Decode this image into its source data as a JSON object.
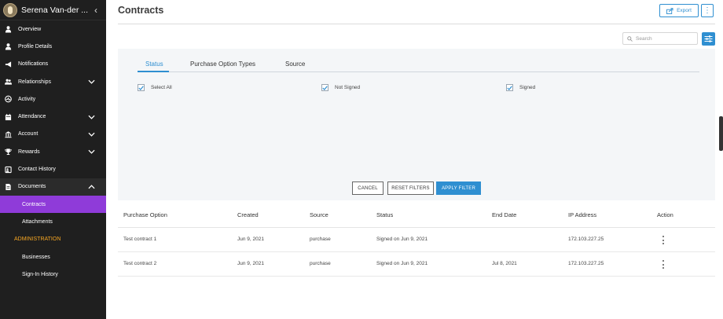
{
  "sidebar": {
    "user_name": "Serena Van-der ...",
    "items": [
      {
        "label": "Overview",
        "icon": "person-icon"
      },
      {
        "label": "Profile Details",
        "icon": "person-icon"
      },
      {
        "label": "Notifications",
        "icon": "megaphone-icon"
      },
      {
        "label": "Relationships",
        "icon": "people-icon"
      },
      {
        "label": "Activity",
        "icon": "activity-icon"
      },
      {
        "label": "Attendance",
        "icon": "calendar-icon"
      },
      {
        "label": "Account",
        "icon": "bank-icon"
      },
      {
        "label": "Rewards",
        "icon": "trophy-icon"
      },
      {
        "label": "Contact History",
        "icon": "contact-icon"
      },
      {
        "label": "Documents",
        "icon": "document-icon"
      }
    ],
    "sub_items": [
      "Contracts",
      "Attachments"
    ],
    "section_label": "ADMINISTRATION",
    "admin_items": [
      "Businesses",
      "Sign-In History"
    ]
  },
  "header": {
    "title": "Contracts",
    "export_label": "Export"
  },
  "search": {
    "placeholder": "Search"
  },
  "filters": {
    "tabs": [
      "Status",
      "Purchase Option Types",
      "Source"
    ],
    "checkboxes": [
      "Select All",
      "Not Signed",
      "Signed"
    ],
    "cancel_label": "CANCEL",
    "reset_label": "RESET FILTERS",
    "apply_label": "APPLY FILTER"
  },
  "table": {
    "columns": [
      "Purchase Option",
      "Created",
      "Source",
      "Status",
      "End Date",
      "IP Address",
      "Action"
    ],
    "rows": [
      {
        "purchase_option": "Test contract 1",
        "created": "Jun 9, 2021",
        "source": "purchase",
        "status": "Signed on Jun 9, 2021",
        "end_date": "",
        "ip": "172.103.227.25"
      },
      {
        "purchase_option": "Test contract 2",
        "created": "Jun 9, 2021",
        "source": "purchase",
        "status": "Signed on Jun 9, 2021",
        "end_date": "Jul 8, 2021",
        "ip": "172.103.227.25"
      }
    ]
  },
  "colors": {
    "accent": "#2f8fd1",
    "active_nav": "#8f3bd9",
    "section": "#f6a623",
    "sidebar_bg": "#1f1f1f"
  }
}
